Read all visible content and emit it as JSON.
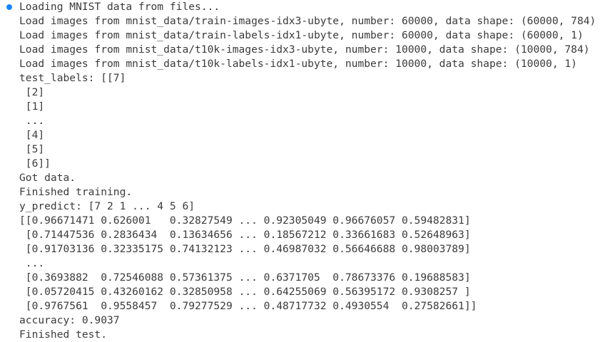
{
  "status": {
    "dot_color": "#1a85ff",
    "icon": "cell-status-dot"
  },
  "text_color": "#3b3b3b",
  "output_lines": [
    "Loading MNIST data from files...",
    "Load images from mnist_data/train-images-idx3-ubyte, number: 60000, data shape: (60000, 784)",
    "Load images from mnist_data/train-labels-idx1-ubyte, number: 60000, data shape: (60000, 1)",
    "Load images from mnist_data/t10k-images-idx3-ubyte, number: 10000, data shape: (10000, 784)",
    "Load images from mnist_data/t10k-labels-idx1-ubyte, number: 10000, data shape: (10000, 1)",
    "test_labels: [[7]",
    " [2]",
    " [1]",
    " ...",
    " [4]",
    " [5]",
    " [6]]",
    "Got data.",
    "Finished training.",
    "y_predict: [7 2 1 ... 4 5 6]",
    "[[0.96671471 0.626001   0.32827549 ... 0.92305049 0.96676057 0.59482831]",
    " [0.71447536 0.2836434  0.13634656 ... 0.18567212 0.33661683 0.52648963]",
    " [0.91703136 0.32335175 0.74132123 ... 0.46987032 0.56646688 0.98003789]",
    " ...",
    " [0.3693882  0.72546088 0.57361375 ... 0.6371705  0.78673376 0.19688583]",
    " [0.05720415 0.43260162 0.32850958 ... 0.64255069 0.56395172 0.9308257 ]",
    " [0.9767561  0.9558457  0.79277529 ... 0.48717732 0.4930554  0.27582661]]",
    "accuracy: 0.9037",
    "Finished test."
  ]
}
